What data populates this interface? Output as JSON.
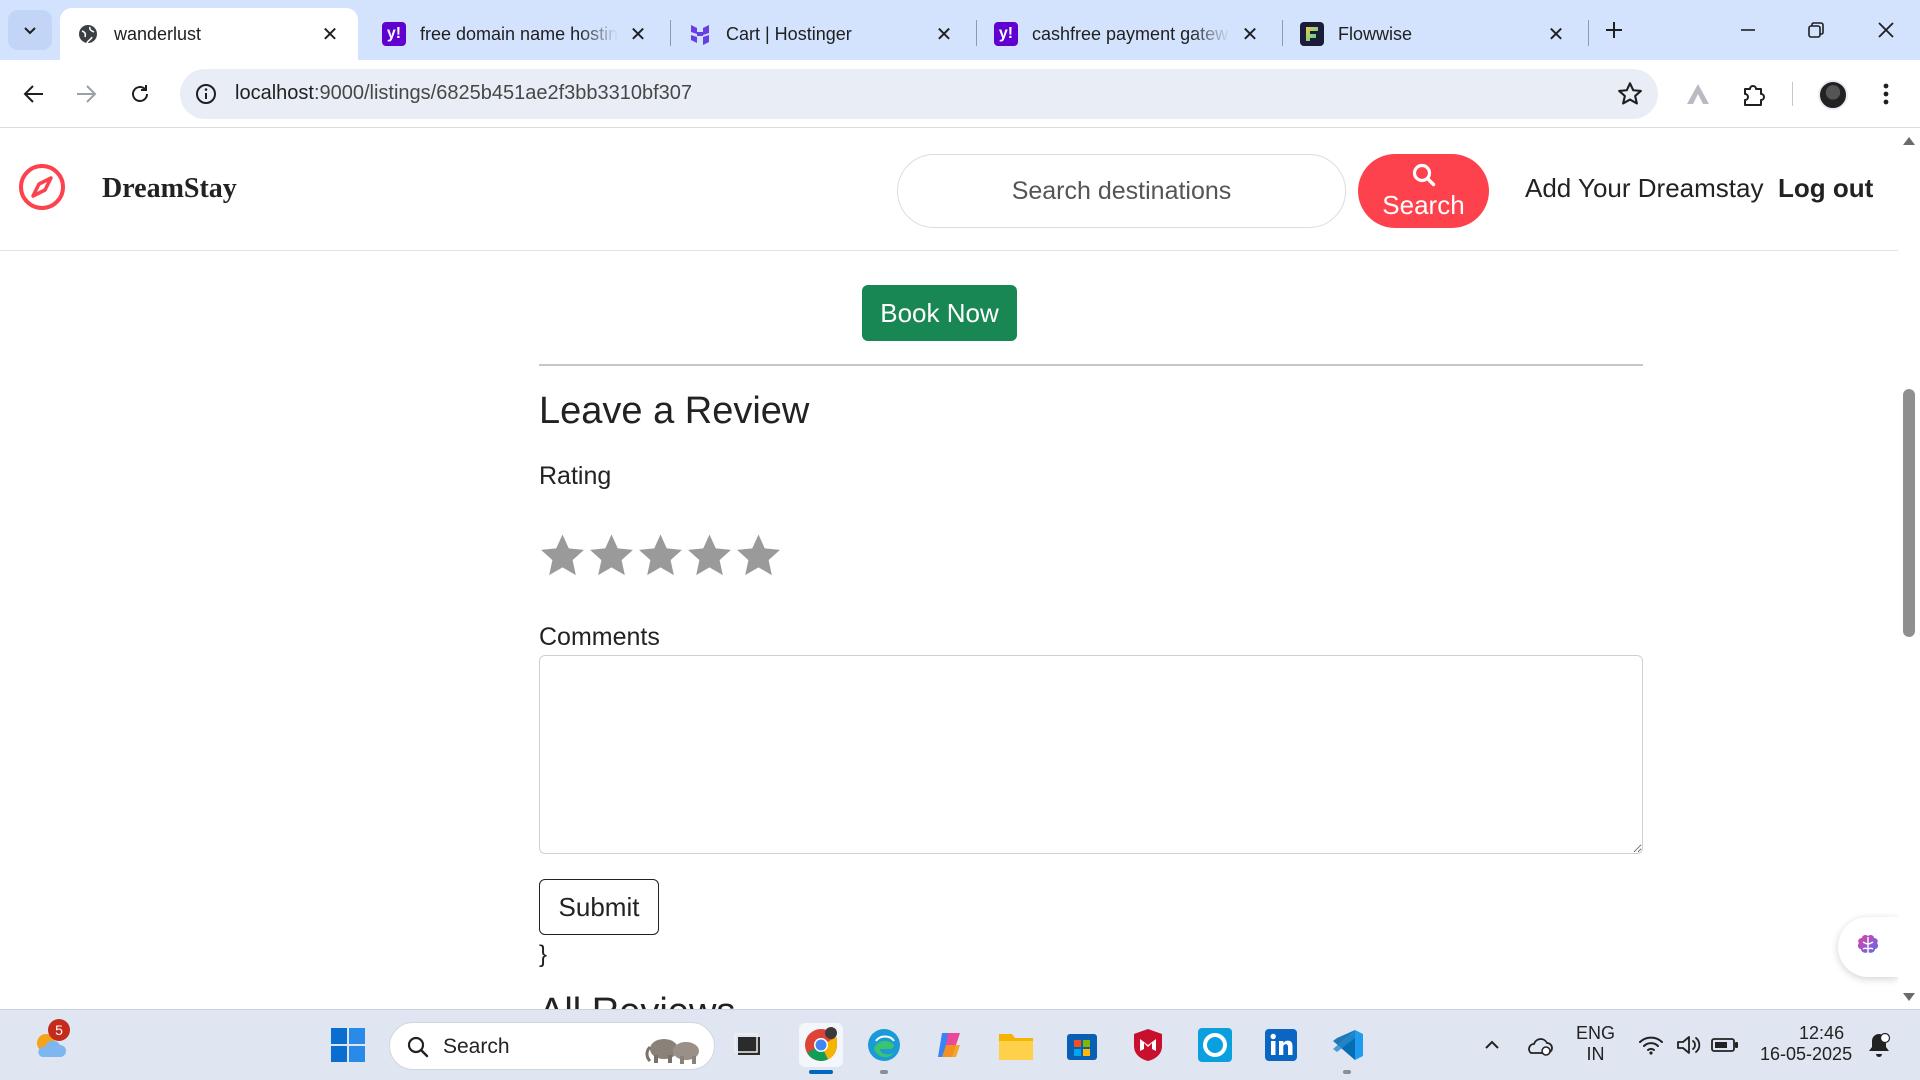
{
  "browser": {
    "tabs": [
      {
        "title": "wanderlust",
        "favicon": "globe-icon",
        "active": true
      },
      {
        "title": "free domain name hostin",
        "favicon": "yahoo-icon",
        "active": false
      },
      {
        "title": "Cart | Hostinger",
        "favicon": "hostinger-icon",
        "active": false
      },
      {
        "title": "cashfree payment gatewa",
        "favicon": "yahoo-icon",
        "active": false
      },
      {
        "title": "Flowwise",
        "favicon": "flowwise-icon",
        "active": false
      }
    ],
    "url_host": "localhost",
    "url_path": ":9000/listings/6825b451ae2f3bb3310bf307"
  },
  "site": {
    "brand": "DreamStay",
    "search_placeholder": "Search destinations",
    "search_button": "Search",
    "nav_add": "Add Your Dreamstay",
    "nav_logout": "Log out",
    "accent_color": "#fe424d"
  },
  "listing": {
    "book_button": "Book Now",
    "book_color": "#198754"
  },
  "review_form": {
    "heading": "Leave a Review",
    "rating_label": "Rating",
    "rating_value": 0,
    "rating_max": 5,
    "comments_label": "Comments",
    "comments_value": "",
    "submit_label": "Submit",
    "stray_text": "}"
  },
  "reviews_section": {
    "heading": "All Reviews"
  },
  "taskbar": {
    "weather_badge": "5",
    "search_label": "Search",
    "lang_top": "ENG",
    "lang_bottom": "IN",
    "time": "12:46",
    "date": "16-05-2025"
  }
}
